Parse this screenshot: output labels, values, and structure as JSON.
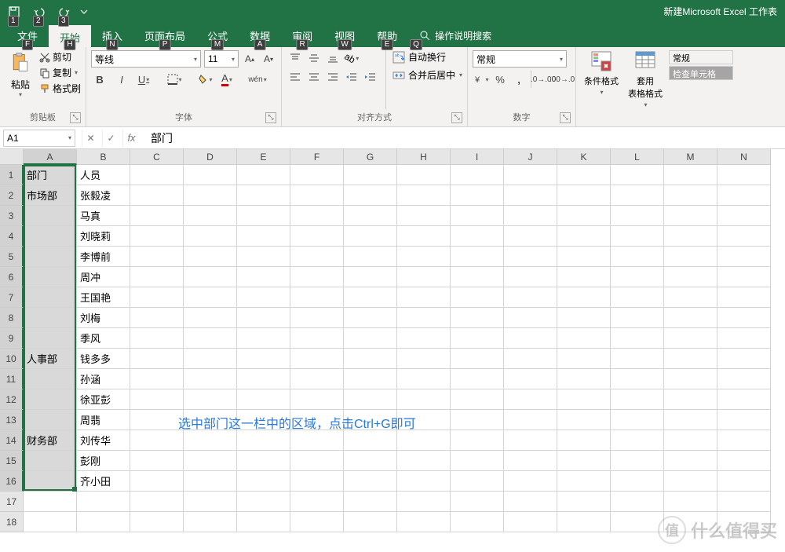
{
  "title": "新建Microsoft Excel 工作表",
  "qat_keys": [
    "1",
    "2",
    "3"
  ],
  "tabs": [
    {
      "label": "文件",
      "key": "F"
    },
    {
      "label": "开始",
      "key": "H",
      "active": true
    },
    {
      "label": "插入",
      "key": "N"
    },
    {
      "label": "页面布局",
      "key": "P"
    },
    {
      "label": "公式",
      "key": "M"
    },
    {
      "label": "数据",
      "key": "A"
    },
    {
      "label": "审阅",
      "key": "R"
    },
    {
      "label": "视图",
      "key": "W"
    },
    {
      "label": "帮助",
      "key": "E"
    }
  ],
  "tellme": {
    "label": "操作说明搜索",
    "key": "Q"
  },
  "clipboard": {
    "paste": "粘贴",
    "cut": "剪切",
    "copy": "复制",
    "painter": "格式刷",
    "group": "剪贴板"
  },
  "font": {
    "name": "等线",
    "size": "11",
    "group": "字体",
    "ruby": "wén"
  },
  "align": {
    "wrap": "自动换行",
    "merge": "合并后居中",
    "group": "对齐方式"
  },
  "number": {
    "format": "常规",
    "group": "数字"
  },
  "styles": {
    "cond": "条件格式",
    "table": "套用\n表格格式",
    "normal": "常规",
    "check": "检查单元格"
  },
  "namebox": "A1",
  "formula": "部门",
  "columns": [
    "A",
    "B",
    "C",
    "D",
    "E",
    "F",
    "G",
    "H",
    "I",
    "J",
    "K",
    "L",
    "M",
    "N"
  ],
  "rows_count": 18,
  "data": {
    "1": {
      "A": "部门",
      "B": "人员"
    },
    "2": {
      "A": "市场部",
      "B": "张毅凌"
    },
    "3": {
      "B": "马真"
    },
    "4": {
      "B": "刘晓莉"
    },
    "5": {
      "B": "李博前"
    },
    "6": {
      "B": "周冲"
    },
    "7": {
      "B": "王国艳"
    },
    "8": {
      "B": "刘梅"
    },
    "9": {
      "B": "季风"
    },
    "10": {
      "A": "人事部",
      "B": "钱多多"
    },
    "11": {
      "B": "孙涵"
    },
    "12": {
      "B": "徐亚彭"
    },
    "13": {
      "B": "周翡"
    },
    "14": {
      "A": "财务部",
      "B": "刘传华"
    },
    "15": {
      "B": "彭刚"
    },
    "16": {
      "B": "齐小田"
    }
  },
  "selected_col": "A",
  "selected_rows": [
    1,
    16
  ],
  "annotation": "选中部门这一栏中的区域，点击Ctrl+G即可",
  "watermark": {
    "ch": "值",
    "text": "什么值得买"
  }
}
